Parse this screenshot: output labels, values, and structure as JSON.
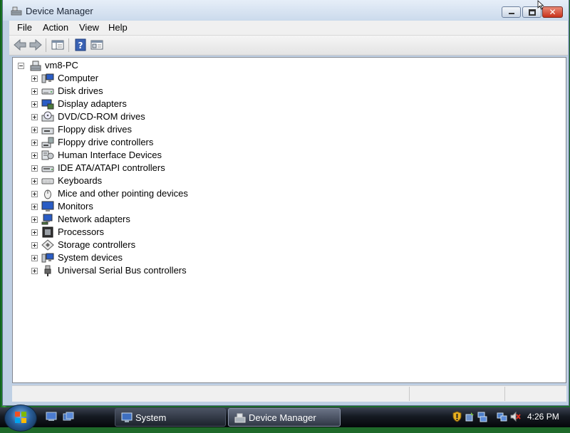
{
  "window": {
    "title": "Device Manager",
    "controls": [
      "minimize",
      "maximize",
      "close"
    ]
  },
  "menu": [
    "File",
    "Action",
    "View",
    "Help"
  ],
  "toolbar": {
    "buttons": [
      "back-icon",
      "forward-icon",
      "show-hide-tree-icon",
      "help-icon",
      "properties-icon"
    ]
  },
  "tree": {
    "root": {
      "label": "vm8-PC",
      "icon": "computer-network-icon",
      "expanded": true
    },
    "items": [
      {
        "label": "Computer",
        "icon": "computer-icon"
      },
      {
        "label": "Disk drives",
        "icon": "disk-drive-icon"
      },
      {
        "label": "Display adapters",
        "icon": "display-adapter-icon"
      },
      {
        "label": "DVD/CD-ROM drives",
        "icon": "dvd-drive-icon"
      },
      {
        "label": "Floppy disk drives",
        "icon": "floppy-drive-icon"
      },
      {
        "label": "Floppy drive controllers",
        "icon": "floppy-controller-icon"
      },
      {
        "label": "Human Interface Devices",
        "icon": "hid-icon"
      },
      {
        "label": "IDE ATA/ATAPI controllers",
        "icon": "ide-controller-icon"
      },
      {
        "label": "Keyboards",
        "icon": "keyboard-icon"
      },
      {
        "label": "Mice and other pointing devices",
        "icon": "mouse-icon"
      },
      {
        "label": "Monitors",
        "icon": "monitor-icon"
      },
      {
        "label": "Network adapters",
        "icon": "network-adapter-icon"
      },
      {
        "label": "Processors",
        "icon": "processor-icon"
      },
      {
        "label": "Storage controllers",
        "icon": "storage-controller-icon"
      },
      {
        "label": "System devices",
        "icon": "system-devices-icon"
      },
      {
        "label": "Universal Serial Bus controllers",
        "icon": "usb-icon"
      }
    ]
  },
  "taskbar": {
    "buttons": [
      {
        "label": "System",
        "icon": "system-icon",
        "active": false
      },
      {
        "label": "Device Manager",
        "icon": "device-manager-icon",
        "active": true
      }
    ],
    "tray_icons": [
      "security-shield-icon",
      "network-status-icon",
      "volume-muted-icon"
    ],
    "clock": "4:26 PM"
  },
  "colors": {
    "title_bar": "#d3e0ef",
    "tree_background": "#ffffff",
    "taskbar": "#151a22",
    "close_button": "#c8321c"
  }
}
